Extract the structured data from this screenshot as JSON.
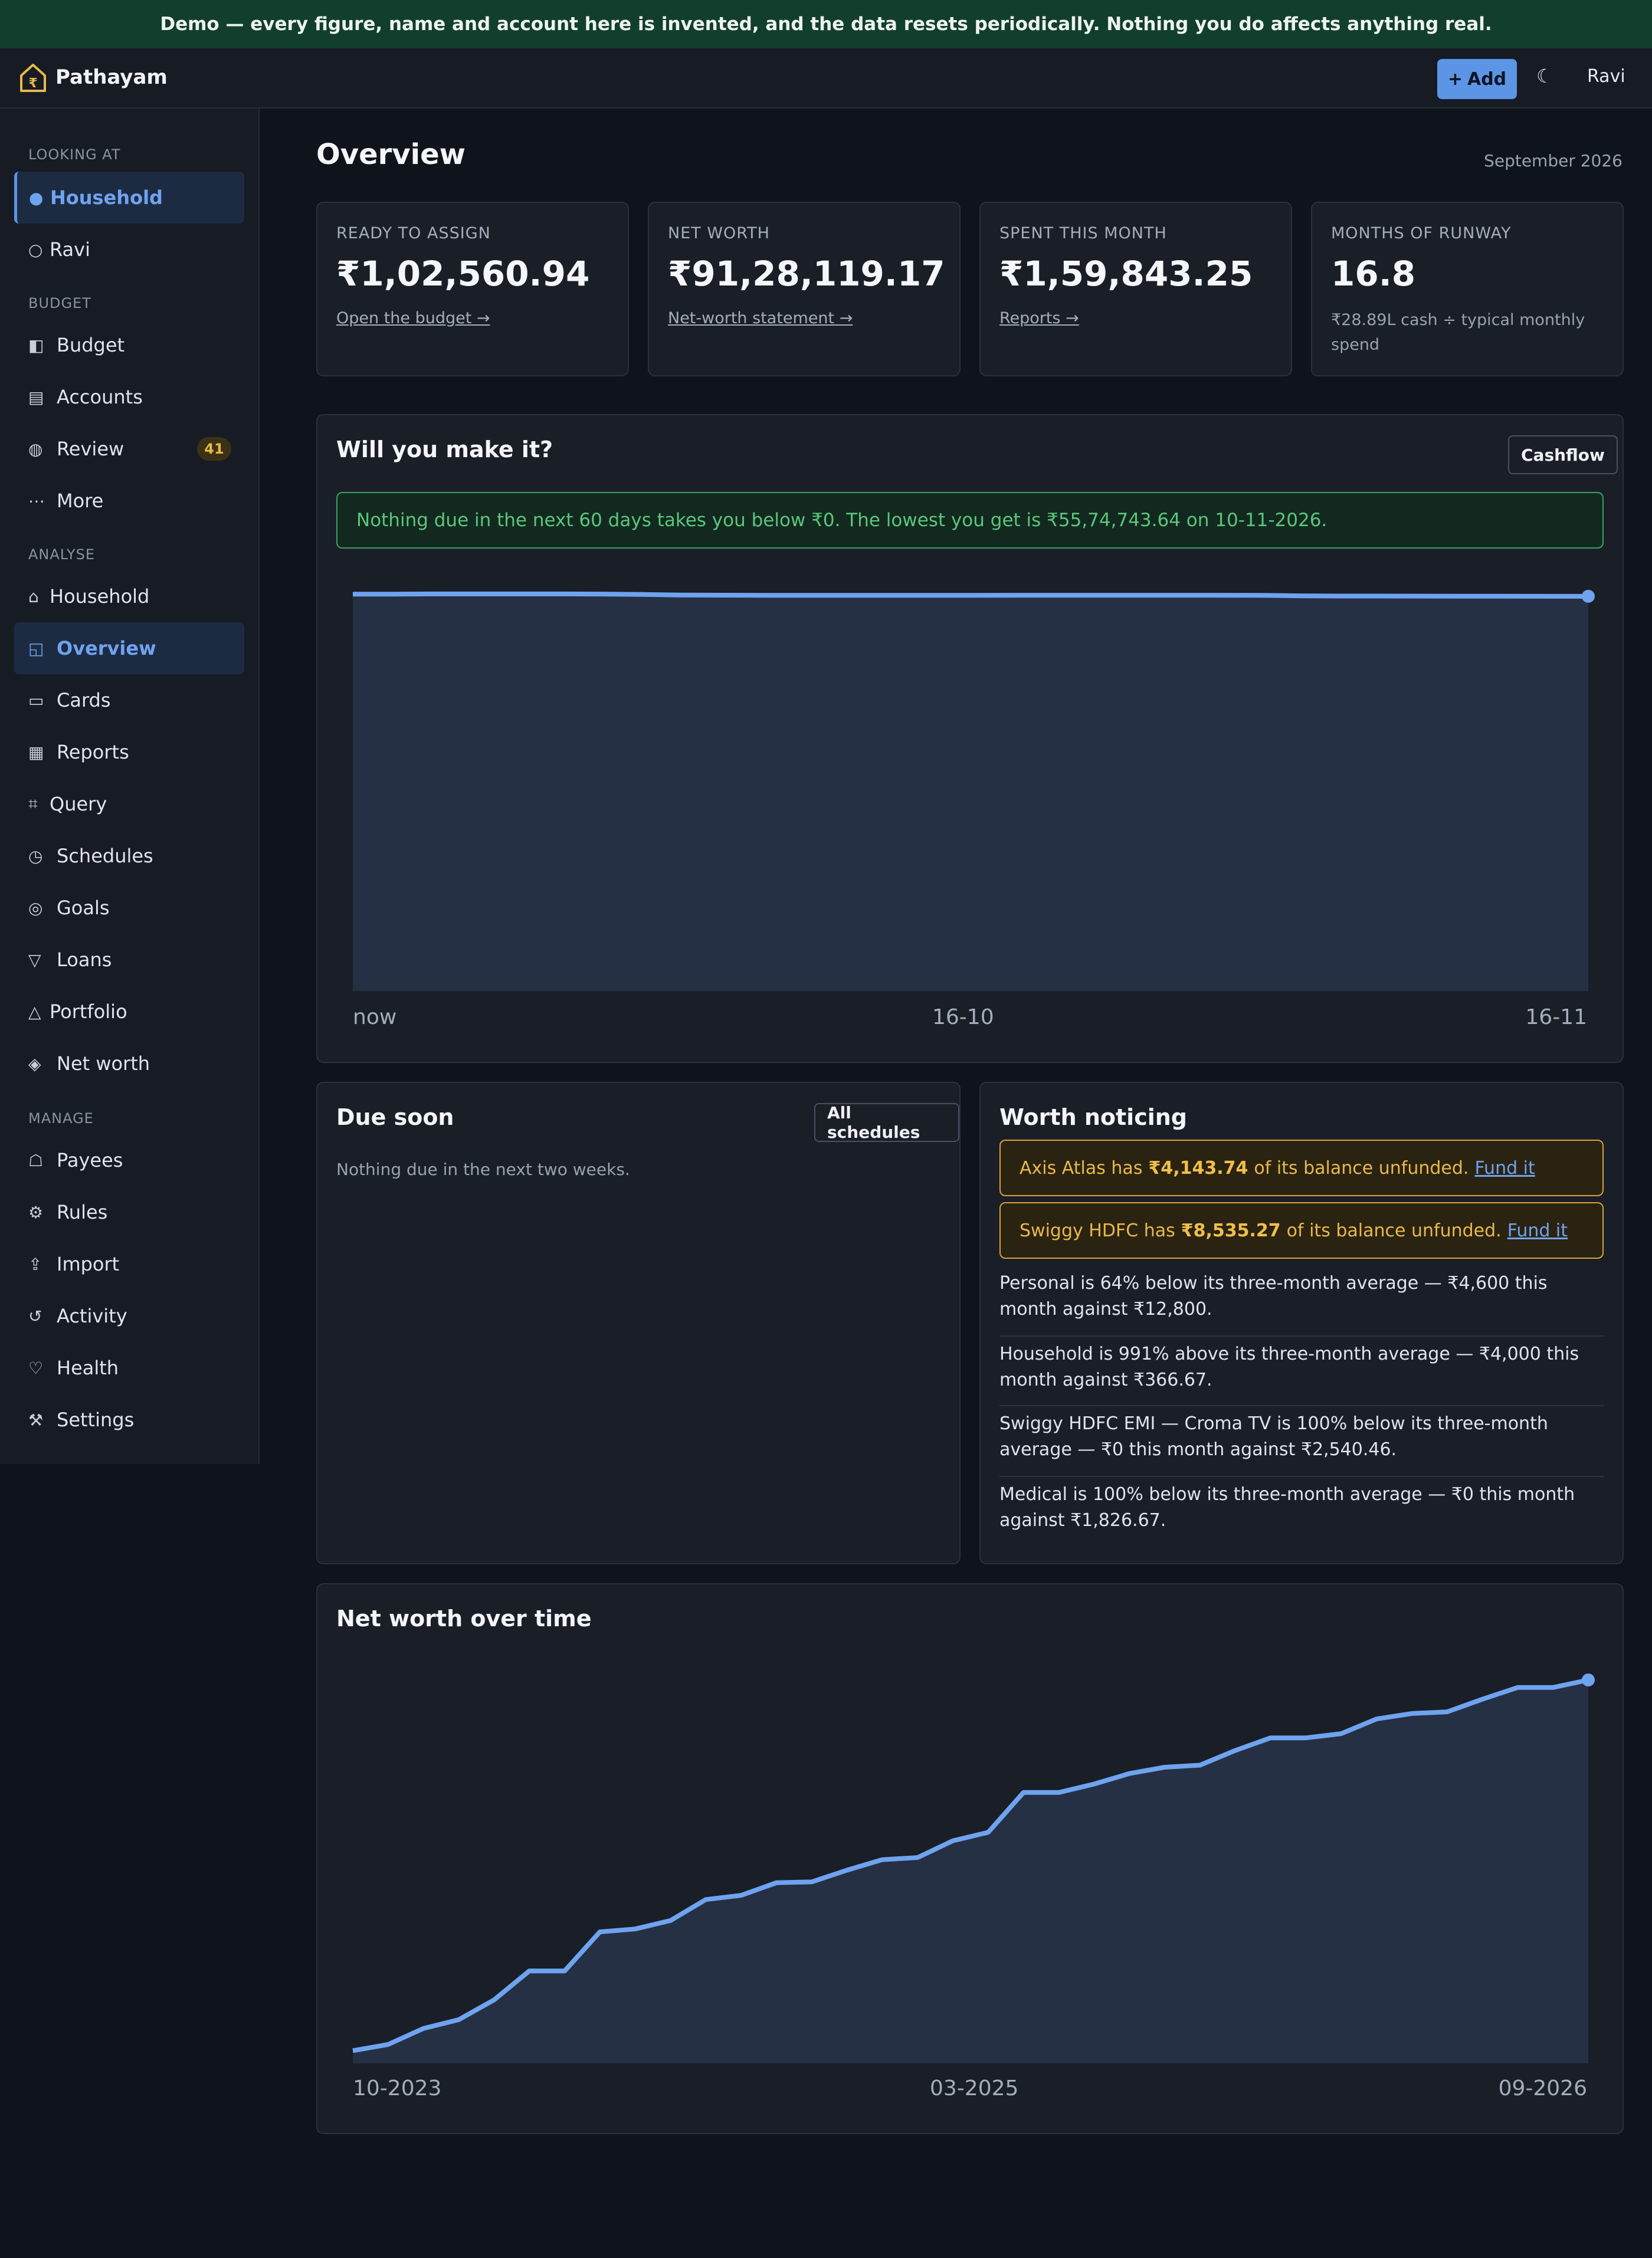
{
  "banner": {
    "text": "Demo — every figure, name and account here is invented, and the data resets periodically. Nothing you do affects anything real."
  },
  "topbar": {
    "brand": "Pathayam",
    "add_label": "Add",
    "add_icon": "+",
    "theme_icon": "☾",
    "user": "Ravi"
  },
  "sidebar": {
    "looking_at": {
      "heading": "LOOKING AT",
      "items": [
        {
          "label": "Household",
          "icon": "●"
        },
        {
          "label": "Ravi",
          "icon": "○"
        }
      ]
    },
    "budget": {
      "heading": "BUDGET",
      "items": [
        {
          "label": "Budget",
          "icon": "◧"
        },
        {
          "label": "Accounts",
          "icon": "▤"
        },
        {
          "label": "Review",
          "icon": "◍",
          "badge": "41"
        },
        {
          "label": "More",
          "icon": "⋯"
        }
      ]
    },
    "analyse": {
      "heading": "ANALYSE",
      "items": [
        {
          "label": "Household",
          "icon": "⌂"
        },
        {
          "label": "Overview",
          "icon": "◱"
        },
        {
          "label": "Cards",
          "icon": "▭"
        },
        {
          "label": "Reports",
          "icon": "▦"
        },
        {
          "label": "Query",
          "icon": "⌗"
        },
        {
          "label": "Schedules",
          "icon": "◷"
        },
        {
          "label": "Goals",
          "icon": "◎"
        },
        {
          "label": "Loans",
          "icon": "▽"
        },
        {
          "label": "Portfolio",
          "icon": "△"
        },
        {
          "label": "Net worth",
          "icon": "◈"
        }
      ]
    },
    "manage": {
      "heading": "MANAGE",
      "items": [
        {
          "label": "Payees",
          "icon": "☖"
        },
        {
          "label": "Rules",
          "icon": "⚙"
        },
        {
          "label": "Import",
          "icon": "⇪"
        },
        {
          "label": "Activity",
          "icon": "↺"
        },
        {
          "label": "Health",
          "icon": "♡"
        },
        {
          "label": "Settings",
          "icon": "⚒"
        }
      ]
    }
  },
  "page": {
    "title": "Overview",
    "month": "September 2026"
  },
  "stats": [
    {
      "label": "READY TO ASSIGN",
      "value": "₹1,02,560.94",
      "link": "Open the budget →"
    },
    {
      "label": "NET WORTH",
      "value": "₹91,28,119.17",
      "link": "Net-worth statement →"
    },
    {
      "label": "SPENT THIS MONTH",
      "value": "₹1,59,843.25",
      "link": "Reports →"
    },
    {
      "label": "MONTHS OF RUNWAY",
      "value": "16.8",
      "note": "₹28.89L cash ÷ typical monthly spend"
    }
  ],
  "cashflow": {
    "title": "Will you make it?",
    "button": "Cashflow",
    "message": "Nothing due in the next 60 days takes you below ₹0. The lowest you get is ₹55,74,743.64 on 10-11-2026."
  },
  "due_soon": {
    "title": "Due soon",
    "button": "All schedules",
    "empty": "Nothing due in the next two weeks."
  },
  "worth_noticing": {
    "title": "Worth noticing",
    "alerts": [
      {
        "pre": "Axis Atlas has",
        "amount": "₹4,143.74",
        "post": "of its balance unfunded.",
        "action": "Fund it"
      },
      {
        "pre": "Swiggy HDFC has",
        "amount": "₹8,535.27",
        "post": "of its balance unfunded.",
        "action": "Fund it"
      }
    ],
    "notes": [
      "Personal is 64% below its three-month average — ₹4,600 this month against ₹12,800.",
      "Household is 991% above its three-month average — ₹4,000 this month against ₹366.67.",
      "Swiggy HDFC EMI — Croma TV is 100% below its three-month average — ₹0 this month against ₹2,540.46.",
      "Medical is 100% below its three-month average — ₹0 this month against ₹1,826.67."
    ]
  },
  "networth": {
    "title": "Net worth over time"
  },
  "chart_data": [
    {
      "type": "area",
      "title": "",
      "xlabel": "",
      "ylabel": "",
      "grid": false,
      "x_tick_labels": [
        "now",
        "16-10",
        "16-11"
      ],
      "x": [
        0,
        2,
        4,
        6,
        8,
        10,
        12,
        14,
        16,
        18,
        20,
        22,
        24,
        26,
        28,
        30,
        32,
        34,
        36,
        38,
        40,
        42,
        44,
        46,
        48,
        50,
        52,
        54,
        56,
        58,
        60
      ],
      "values": [
        56.8,
        56.8,
        56.82,
        56.82,
        56.82,
        56.82,
        56.81,
        56.75,
        56.66,
        56.65,
        56.63,
        56.63,
        56.62,
        56.62,
        56.62,
        56.62,
        56.64,
        56.64,
        56.64,
        56.64,
        56.64,
        56.64,
        56.63,
        56.55,
        56.52,
        56.52,
        56.51,
        56.5,
        56.5,
        56.49,
        56.49
      ],
      "ylim": [
        0,
        56.9
      ],
      "color": "#6ea3ef",
      "fill": "#253044"
    },
    {
      "type": "area",
      "title": "",
      "xlabel": "",
      "ylabel": "",
      "grid": false,
      "x_tick_labels": [
        "10-2023",
        "03-2025",
        "09-2026"
      ],
      "x": [
        "10-2023",
        "11-2023",
        "12-2023",
        "01-2024",
        "02-2024",
        "03-2024",
        "04-2024",
        "05-2024",
        "06-2024",
        "07-2024",
        "08-2024",
        "09-2024",
        "10-2024",
        "11-2024",
        "12-2024",
        "01-2025",
        "02-2025",
        "03-2025",
        "04-2025",
        "05-2025",
        "06-2025",
        "07-2025",
        "08-2025",
        "09-2025",
        "10-2025",
        "11-2025",
        "12-2025",
        "01-2026",
        "02-2026",
        "03-2026",
        "04-2026",
        "05-2026",
        "06-2026",
        "07-2026",
        "08-2026",
        "09-2026"
      ],
      "values": [
        3.0,
        4.5,
        8.3,
        10.4,
        15.1,
        22.0,
        22.0,
        31.3,
        32.0,
        34.0,
        39.0,
        40.0,
        43.0,
        43.2,
        46.0,
        48.5,
        49.0,
        53.0,
        55.0,
        64.5,
        64.5,
        66.5,
        69.0,
        70.5,
        71.0,
        74.5,
        77.5,
        77.5,
        78.5,
        82.0,
        83.3,
        83.7,
        86.7,
        89.5,
        89.5,
        91.28
      ],
      "ylim": [
        0,
        100
      ],
      "color": "#6ea3ef",
      "fill": "#253044"
    }
  ]
}
